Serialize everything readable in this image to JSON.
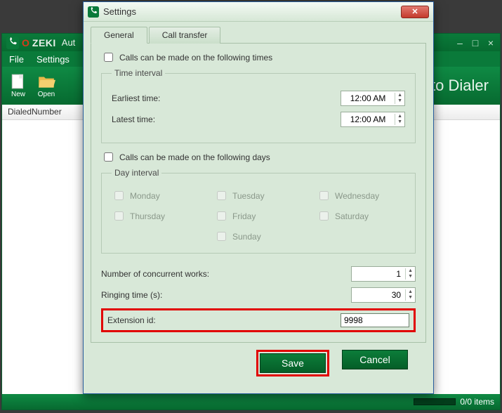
{
  "app": {
    "brand_o": "O",
    "brand_rest": "ZEKI",
    "title_suffix": "Aut",
    "title_right": "Auto Dialer",
    "menu": {
      "file": "File",
      "settings": "Settings"
    },
    "toolbar": {
      "new": "New",
      "open": "Open"
    },
    "column_header": "DialedNumber",
    "status": "0/0 items"
  },
  "dialog": {
    "title": "Settings",
    "tabs": {
      "general": "General",
      "call_transfer": "Call transfer"
    },
    "times_check": "Calls can be made on the following times",
    "time_interval": {
      "legend": "Time interval",
      "earliest_label": "Earliest time:",
      "earliest_value": "12:00 AM",
      "latest_label": "Latest time:",
      "latest_value": "12:00 AM"
    },
    "days_check": "Calls can be made on the following days",
    "day_interval": {
      "legend": "Day interval",
      "monday": "Monday",
      "tuesday": "Tuesday",
      "wednesday": "Wednesday",
      "thursday": "Thursday",
      "friday": "Friday",
      "saturday": "Saturday",
      "sunday": "Sunday"
    },
    "concurrent_label": "Number of concurrent works:",
    "concurrent_value": "1",
    "ringing_label": "Ringing time (s):",
    "ringing_value": "30",
    "extension_label": "Extension id:",
    "extension_value": "9998",
    "save": "Save",
    "cancel": "Cancel"
  }
}
